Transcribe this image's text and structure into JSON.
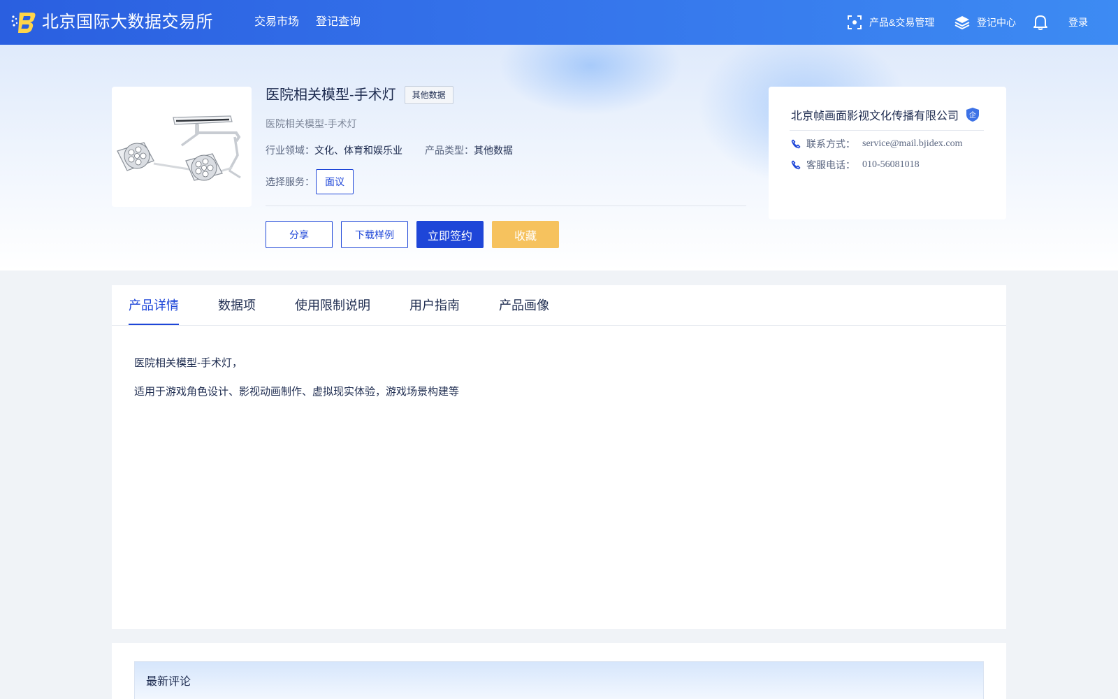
{
  "header": {
    "brand": "北京国际大数据交易所",
    "nav_main": [
      "交易市场",
      "登记查询"
    ],
    "nav_product_mgmt": "产品&交易管理",
    "nav_register_center": "登记中心",
    "login": "登录"
  },
  "product": {
    "title": "医院相关模型-手术灯",
    "tag": "其他数据",
    "subtitle": "医院相关模型-手术灯",
    "industry_label": "行业领域：",
    "industry_value": "文化、体育和娱乐业",
    "type_label": "产品类型：",
    "type_value": "其他数据",
    "service_label": "选择服务：",
    "service_option": "面议",
    "actions": {
      "share": "分享",
      "download_sample": "下载样例",
      "sign_now": "立即签约",
      "favorite": "收藏"
    }
  },
  "company": {
    "name": "北京帧画面影视文化传播有限公司",
    "badge": "企",
    "contact_label": "联系方式：",
    "contact_value": "service@mail.bjidex.com",
    "phone_label": "客服电话：",
    "phone_value": "010-56081018"
  },
  "tabs": [
    "产品详情",
    "数据项",
    "使用限制说明",
    "用户指南",
    "产品画像"
  ],
  "active_tab": "产品详情",
  "detail": {
    "line1": "医院相关模型-手术灯，",
    "line2": "适用于游戏角色设计、影视动画制作、虚拟现实体验，游戏场景构建等"
  },
  "comments": {
    "title": "最新评论"
  },
  "colors": {
    "primary": "#1e46d8",
    "header_start": "#2a5fe0",
    "header_end": "#3d8bf3",
    "favorite": "#f6c25e"
  },
  "icons": {
    "logo": "bidex-logo",
    "product_mgmt": "scan-frame-icon",
    "register_center": "layers-icon",
    "notifications": "bell-icon",
    "company_badge": "shield-icon",
    "contact": "phone-icon"
  }
}
